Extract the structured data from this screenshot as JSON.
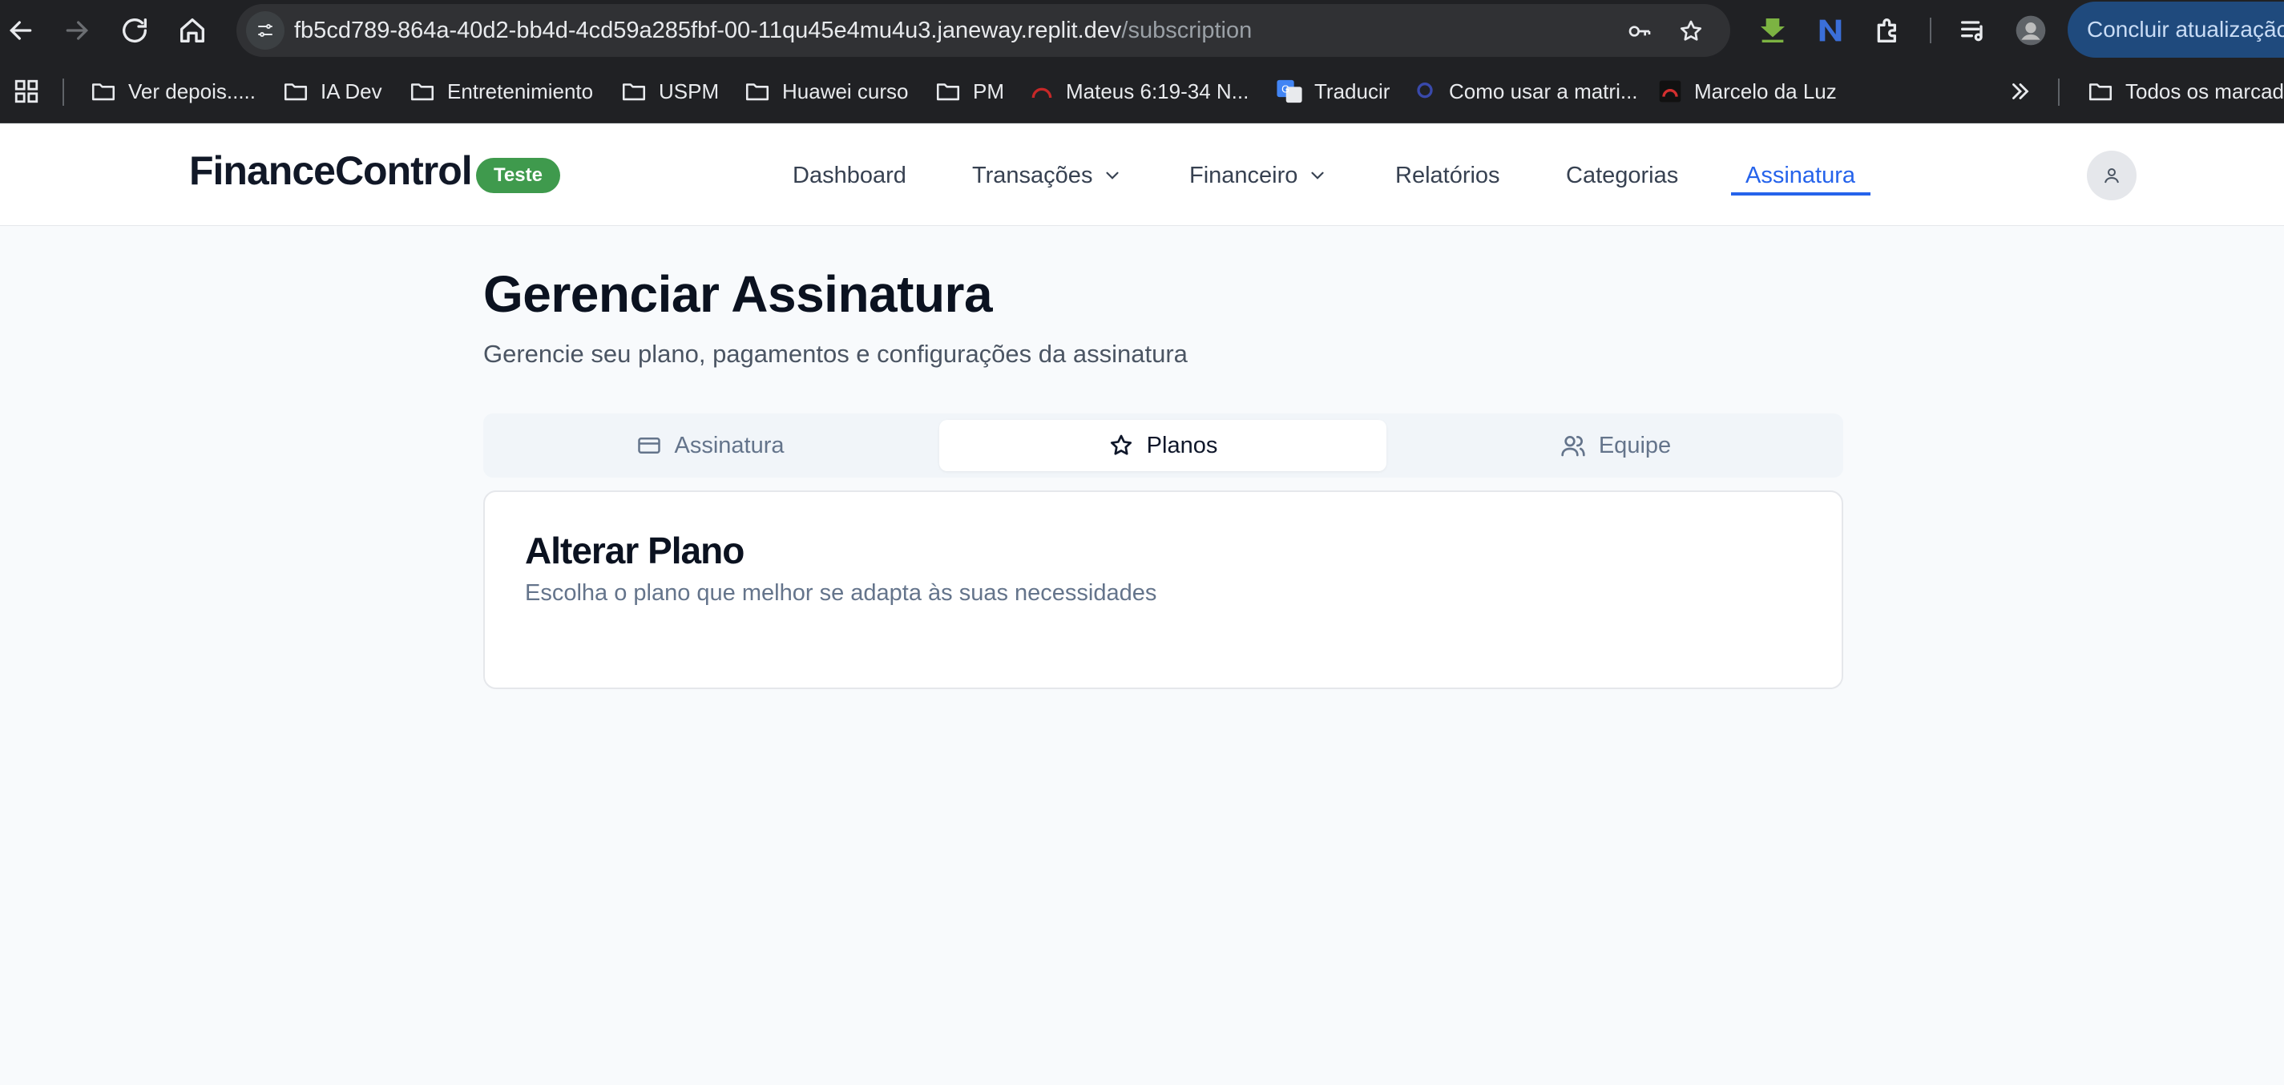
{
  "browser": {
    "url_host": "fb5cd789-864a-40d2-bb4d-4cd59a285fbf-00-11qu45e4mu4u3.janeway.replit.dev",
    "url_path": "/subscription",
    "update_button_label": "Concluir atualização"
  },
  "bookmarks": [
    {
      "label": "Ver depois.....",
      "icon": "folder-icon"
    },
    {
      "label": "IA Dev",
      "icon": "folder-icon"
    },
    {
      "label": "Entretenimiento",
      "icon": "folder-icon"
    },
    {
      "label": "USPM",
      "icon": "folder-icon"
    },
    {
      "label": "Huawei curso",
      "icon": "folder-icon"
    },
    {
      "label": "PM",
      "icon": "folder-icon"
    },
    {
      "label": "Mateus 6:19-34 N...",
      "icon": "site-icon"
    },
    {
      "label": "Traducir",
      "icon": "translate-icon"
    },
    {
      "label": "Como usar a matri...",
      "icon": "site-icon"
    },
    {
      "label": "Marcelo da Luz",
      "icon": "site-icon"
    }
  ],
  "bookmarks_all_label": "Todos os marcadores",
  "app": {
    "brand": "FinanceControl",
    "badge": "Teste",
    "nav": [
      {
        "label": "Dashboard"
      },
      {
        "label": "Transações"
      },
      {
        "label": "Financeiro"
      },
      {
        "label": "Relatórios"
      },
      {
        "label": "Categorias"
      },
      {
        "label": "Assinatura"
      }
    ],
    "active_nav": "Assinatura"
  },
  "page": {
    "title": "Gerenciar Assinatura",
    "subtitle": "Gerencie seu plano, pagamentos e configurações da assinatura",
    "tabs": [
      {
        "label": "Assinatura",
        "icon": "credit-card-icon"
      },
      {
        "label": "Planos",
        "icon": "star-icon"
      },
      {
        "label": "Equipe",
        "icon": "users-icon"
      }
    ],
    "active_tab": "Planos",
    "card": {
      "title": "Alterar Plano",
      "description": "Escolha o plano que melhor se adapta às suas necessidades"
    }
  },
  "colors": {
    "accent": "#2563eb",
    "badge": "#3f9a4d",
    "browser_bg": "#202124"
  }
}
